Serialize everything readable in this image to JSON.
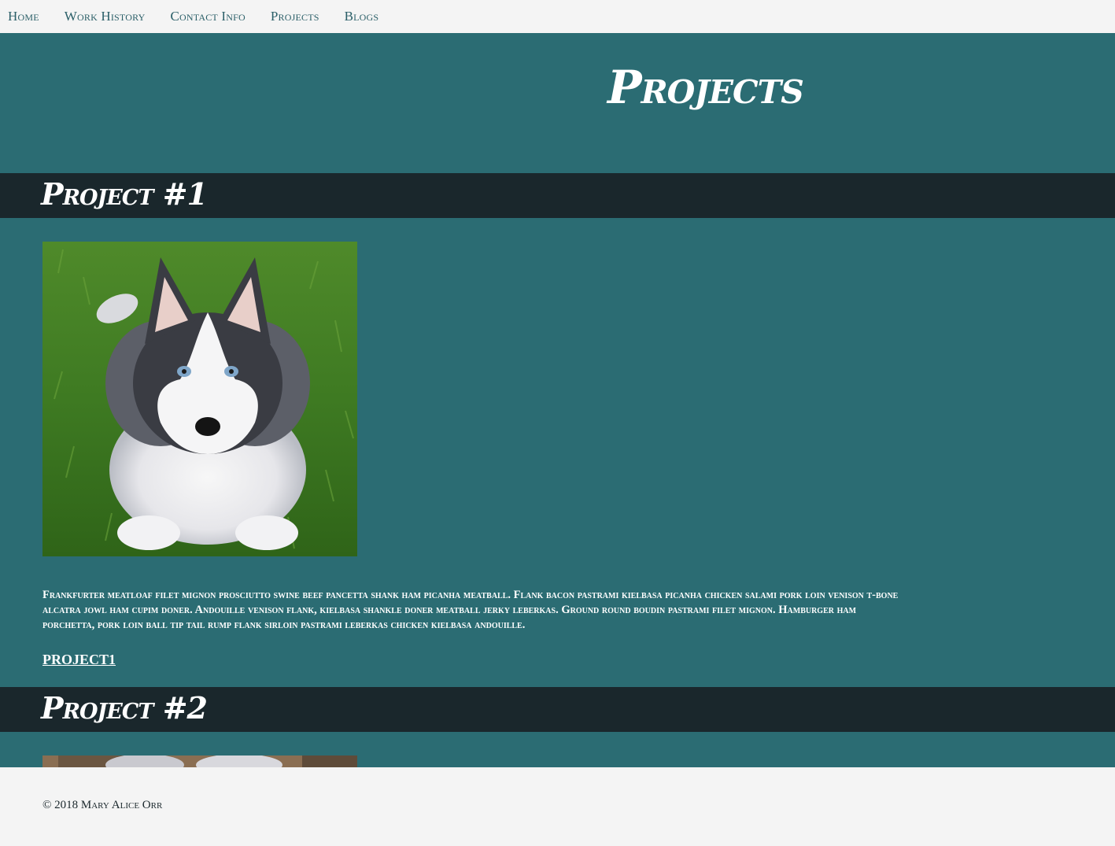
{
  "nav": {
    "items": [
      {
        "label": "Home"
      },
      {
        "label": "Work History"
      },
      {
        "label": "Contact Info"
      },
      {
        "label": "Projects"
      },
      {
        "label": "Blogs"
      }
    ]
  },
  "page": {
    "title": "Projects"
  },
  "projects": [
    {
      "heading": "Project #1",
      "image_icon": "husky-puppy-photo",
      "description": "Frankfurter meatloaf filet mignon prosciutto swine beef pancetta shank ham picanha meatball. Flank bacon pastrami kielbasa picanha chicken salami pork loin venison t-bone alcatra jowl ham cupim doner. Andouille venison flank, kielbasa shankle doner meatball jerky leberkas. Ground round boudin pastrami filet mignon. Hamburger ham porchetta, pork loin ball tip tail rump flank sirloin pastrami leberkas chicken kielbasa andouille.",
      "link_label": "PROJECT1"
    },
    {
      "heading": "Project #2",
      "image_icon": "husky-puppies-photo"
    }
  ],
  "footer": {
    "copyright": "© 2018 Mary Alice Orr"
  },
  "colors": {
    "main_bg": "#2b6c73",
    "section_bar": "#1a272c",
    "nav_bg": "#f4f4f4",
    "nav_text": "#2b5f68"
  }
}
